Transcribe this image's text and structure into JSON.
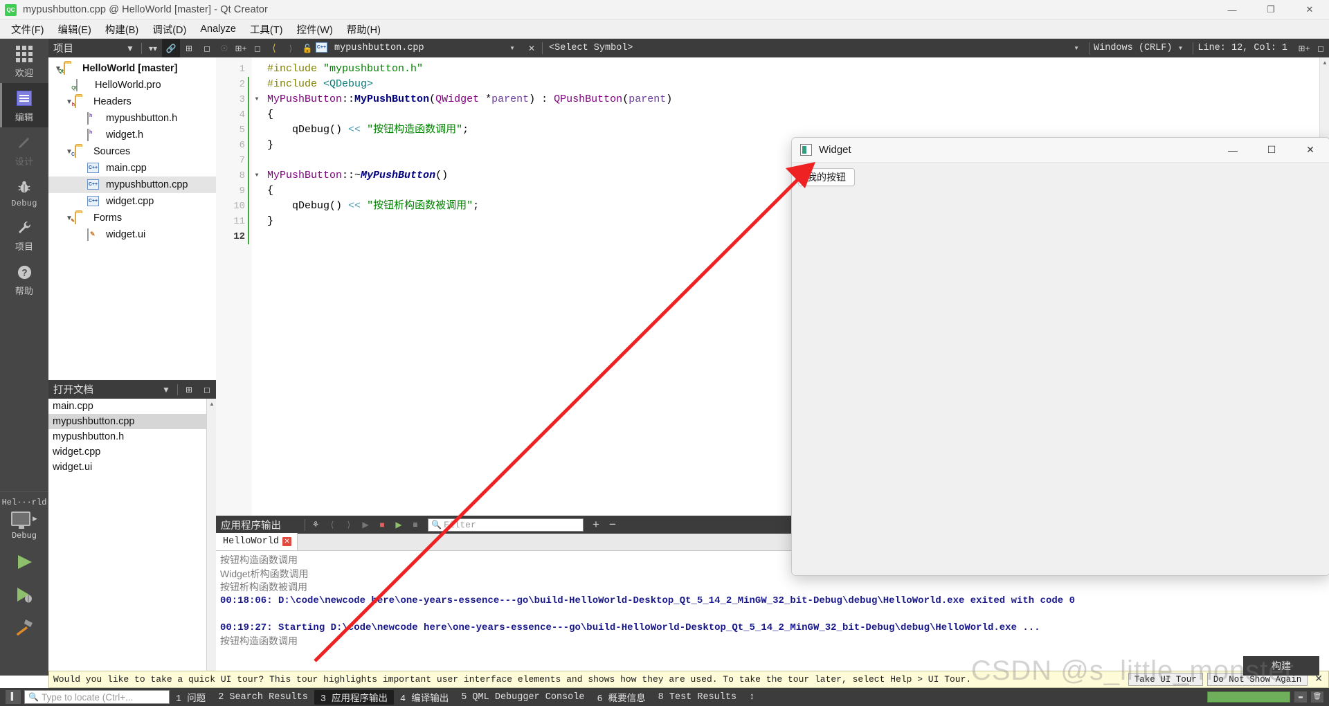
{
  "window": {
    "title": "mypushbutton.cpp @ HelloWorld [master] - Qt Creator",
    "logo": "qt-creator-logo",
    "minimize": "—",
    "restore": "❐",
    "close": "✕"
  },
  "menubar": {
    "items": [
      {
        "label": "文件(F)",
        "name": "menu-file"
      },
      {
        "label": "编辑(E)",
        "name": "menu-edit"
      },
      {
        "label": "构建(B)",
        "name": "menu-build"
      },
      {
        "label": "调试(D)",
        "name": "menu-debug"
      },
      {
        "label": "Analyze",
        "name": "menu-analyze"
      },
      {
        "label": "工具(T)",
        "name": "menu-tools"
      },
      {
        "label": "控件(W)",
        "name": "menu-window"
      },
      {
        "label": "帮助(H)",
        "name": "menu-help"
      }
    ]
  },
  "modebar": {
    "modes": [
      {
        "label": "欢迎",
        "name": "mode-welcome",
        "icon": "grid-icon",
        "state": "normal"
      },
      {
        "label": "编辑",
        "name": "mode-edit",
        "icon": "edit-icon",
        "state": "active"
      },
      {
        "label": "设计",
        "name": "mode-design",
        "icon": "pencil-icon",
        "state": "disabled"
      },
      {
        "label": "Debug",
        "name": "mode-debug",
        "icon": "bug-icon",
        "state": "normal"
      },
      {
        "label": "项目",
        "name": "mode-projects",
        "icon": "wrench-icon",
        "state": "normal"
      },
      {
        "label": "帮助",
        "name": "mode-help",
        "icon": "question-icon",
        "state": "normal"
      }
    ],
    "kit_name": "Hel···rld",
    "kit_mode": "Debug",
    "run_label": "run-button",
    "debug_label": "debug-button",
    "build_label": "build-button"
  },
  "projects_panel": {
    "title": "项目",
    "tree": [
      {
        "label": "HelloWorld [master]",
        "icon": "qt-project-folder-icon",
        "depth": 0,
        "expanded": true,
        "bold": true,
        "selected": false
      },
      {
        "label": "HelloWorld.pro",
        "icon": "qt-pro-file-icon",
        "depth": 1,
        "expanded": null,
        "bold": false,
        "selected": false
      },
      {
        "label": "Headers",
        "icon": "headers-folder-icon",
        "depth": 1,
        "expanded": true,
        "bold": false,
        "selected": false
      },
      {
        "label": "mypushbutton.h",
        "icon": "header-file-icon",
        "depth": 2,
        "expanded": null,
        "bold": false,
        "selected": false
      },
      {
        "label": "widget.h",
        "icon": "header-file-icon",
        "depth": 2,
        "expanded": null,
        "bold": false,
        "selected": false
      },
      {
        "label": "Sources",
        "icon": "sources-folder-icon",
        "depth": 1,
        "expanded": true,
        "bold": false,
        "selected": false
      },
      {
        "label": "main.cpp",
        "icon": "cpp-file-icon",
        "depth": 2,
        "expanded": null,
        "bold": false,
        "selected": false
      },
      {
        "label": "mypushbutton.cpp",
        "icon": "cpp-file-icon",
        "depth": 2,
        "expanded": null,
        "bold": false,
        "selected": true
      },
      {
        "label": "widget.cpp",
        "icon": "cpp-file-icon",
        "depth": 2,
        "expanded": null,
        "bold": false,
        "selected": false
      },
      {
        "label": "Forms",
        "icon": "forms-folder-icon",
        "depth": 1,
        "expanded": true,
        "bold": false,
        "selected": false
      },
      {
        "label": "widget.ui",
        "icon": "ui-file-icon",
        "depth": 2,
        "expanded": null,
        "bold": false,
        "selected": false
      }
    ]
  },
  "open_documents": {
    "title": "打开文档",
    "items": [
      {
        "label": "main.cpp",
        "selected": false
      },
      {
        "label": "mypushbutton.cpp",
        "selected": true
      },
      {
        "label": "mypushbutton.h",
        "selected": false
      },
      {
        "label": "widget.cpp",
        "selected": false
      },
      {
        "label": "widget.ui",
        "selected": false
      }
    ]
  },
  "editor_toolbar": {
    "current_file": "mypushbutton.cpp",
    "symbol_placeholder": "<Select Symbol>",
    "line_ending": "Windows (CRLF)",
    "cursor_position": "Line: 12, Col: 1"
  },
  "code": {
    "lines": [
      {
        "n": "1",
        "fold": null,
        "green": false,
        "tokens": [
          {
            "t": "#include ",
            "c": "k-pre"
          },
          {
            "t": "\"mypushbutton.h\"",
            "c": "k-str"
          }
        ]
      },
      {
        "n": "2",
        "fold": null,
        "green": true,
        "tokens": [
          {
            "t": "#include ",
            "c": "k-pre"
          },
          {
            "t": "<QDebug>",
            "c": "k-inc"
          }
        ]
      },
      {
        "n": "3",
        "fold": "▼",
        "green": true,
        "tokens": [
          {
            "t": "MyPushButton",
            "c": "k-typep"
          },
          {
            "t": "::",
            "c": "k-plain"
          },
          {
            "t": "MyPushButton",
            "c": "k-func"
          },
          {
            "t": "(",
            "c": "k-plain"
          },
          {
            "t": "QWidget",
            "c": "k-typep"
          },
          {
            "t": " *",
            "c": "k-plain"
          },
          {
            "t": "parent",
            "c": "k-param"
          },
          {
            "t": ") : ",
            "c": "k-plain"
          },
          {
            "t": "QPushButton",
            "c": "k-typep"
          },
          {
            "t": "(",
            "c": "k-plain"
          },
          {
            "t": "parent",
            "c": "k-param"
          },
          {
            "t": ")",
            "c": "k-plain"
          }
        ]
      },
      {
        "n": "4",
        "fold": null,
        "green": true,
        "tokens": [
          {
            "t": "{",
            "c": "k-plain"
          }
        ]
      },
      {
        "n": "5",
        "fold": null,
        "green": true,
        "tokens": [
          {
            "t": "    qDebug",
            "c": "k-plain"
          },
          {
            "t": "() ",
            "c": "k-plain"
          },
          {
            "t": "<<",
            "c": "k-op"
          },
          {
            "t": " ",
            "c": "k-plain"
          },
          {
            "t": "\"按钮构造函数调用\"",
            "c": "k-str"
          },
          {
            "t": ";",
            "c": "k-plain"
          }
        ]
      },
      {
        "n": "6",
        "fold": null,
        "green": true,
        "tokens": [
          {
            "t": "}",
            "c": "k-plain"
          }
        ]
      },
      {
        "n": "7",
        "fold": null,
        "green": true,
        "tokens": [
          {
            "t": "",
            "c": "k-plain"
          }
        ]
      },
      {
        "n": "8",
        "fold": "▼",
        "green": true,
        "tokens": [
          {
            "t": "MyPushButton",
            "c": "k-typep"
          },
          {
            "t": "::~",
            "c": "k-plain"
          },
          {
            "t": "MyPushButton",
            "c": "k-funcitalic"
          },
          {
            "t": "()",
            "c": "k-plain"
          }
        ]
      },
      {
        "n": "9",
        "fold": null,
        "green": true,
        "tokens": [
          {
            "t": "{",
            "c": "k-plain"
          }
        ]
      },
      {
        "n": "10",
        "fold": null,
        "green": true,
        "tokens": [
          {
            "t": "    qDebug",
            "c": "k-plain"
          },
          {
            "t": "() ",
            "c": "k-plain"
          },
          {
            "t": "<<",
            "c": "k-op"
          },
          {
            "t": " ",
            "c": "k-plain"
          },
          {
            "t": "\"按钮析构函数被调用\"",
            "c": "k-str"
          },
          {
            "t": ";",
            "c": "k-plain"
          }
        ]
      },
      {
        "n": "11",
        "fold": null,
        "green": true,
        "tokens": [
          {
            "t": "}",
            "c": "k-plain"
          }
        ]
      },
      {
        "n": "12",
        "fold": null,
        "green": true,
        "current": true,
        "tokens": [
          {
            "t": "",
            "c": "k-plain"
          }
        ]
      }
    ]
  },
  "output_pane": {
    "title": "应用程序输出",
    "filter_placeholder": "Filter",
    "tab_label": "HelloWorld",
    "tab_close": "✕",
    "add_label": "+",
    "remove_label": "−",
    "lines": [
      {
        "text": "按钮构造函数调用",
        "style": "gray"
      },
      {
        "text": "Widget析构函数调用",
        "style": "gray"
      },
      {
        "text": "按钮析构函数被调用",
        "style": "gray"
      },
      {
        "text": "00:18:06: D:\\code\\newcode here\\one-years-essence---go\\build-HelloWorld-Desktop_Qt_5_14_2_MinGW_32_bit-Debug\\debug\\HelloWorld.exe exited with code 0",
        "style": "blue"
      },
      {
        "text": "",
        "style": "blank"
      },
      {
        "text": "00:19:27: Starting D:\\code\\newcode here\\one-years-essence---go\\build-HelloWorld-Desktop_Qt_5_14_2_MinGW_32_bit-Debug\\debug\\HelloWorld.exe ...",
        "style": "blue"
      },
      {
        "text": "按钮构造函数调用",
        "style": "gray"
      }
    ]
  },
  "widget_window": {
    "title": "Widget",
    "button_label": "我的按钮",
    "minimize": "—",
    "maximize": "☐",
    "close": "✕"
  },
  "tour_banner": {
    "message": "Would you like to take a quick UI tour? This tour highlights important user interface elements and shows how they are used. To take the tour later, select Help > UI Tour.",
    "take_tour": "Take UI Tour",
    "do_not_show": "Do Not Show Again",
    "close": "✕"
  },
  "statusbar": {
    "locate_placeholder": "Type to locate (Ctrl+...",
    "items": [
      {
        "label": "1 问题",
        "active": false
      },
      {
        "label": "2 Search Results",
        "active": false
      },
      {
        "label": "3 应用程序输出",
        "active": true
      },
      {
        "label": "4 编译输出",
        "active": false
      },
      {
        "label": "5 QML Debugger Console",
        "active": false
      },
      {
        "label": "6 概要信息",
        "active": false
      },
      {
        "label": "8 Test Results",
        "active": false
      }
    ],
    "spinner": "↕"
  },
  "build_tooltip": {
    "label": "构建"
  },
  "watermark": {
    "text": "CSDN @s_little_monster"
  },
  "colors": {
    "accent_green": "#41cd52",
    "panel_dark": "#3c3c3c",
    "modebar": "#464646",
    "selection": "#e4e4e4",
    "arrow_red": "#ee2222",
    "banner_yellow": "#fdfbd8"
  }
}
